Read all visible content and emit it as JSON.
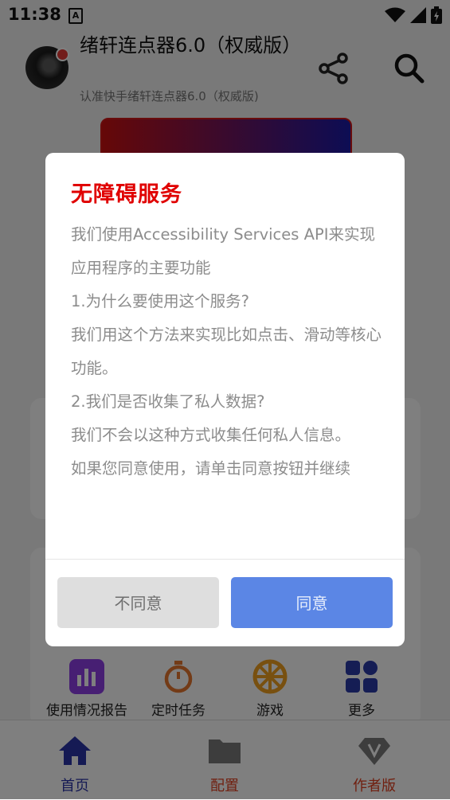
{
  "status_bar": {
    "time": "11:38",
    "notification_icon": "A"
  },
  "header": {
    "title": "绪轩连点器6.0（权威版）",
    "subtitle": "认准快手绪轩连点器6.0（权威版)"
  },
  "quick_actions": [
    {
      "label": "使用情况报告",
      "icon": "bar-chart-icon"
    },
    {
      "label": "定时任务",
      "icon": "stopwatch-icon"
    },
    {
      "label": "游戏",
      "icon": "wheel-icon"
    },
    {
      "label": "更多",
      "icon": "grid-icon"
    }
  ],
  "bottom_nav": [
    {
      "label": "首页",
      "icon": "home-icon",
      "active": true
    },
    {
      "label": "配置",
      "icon": "folder-icon",
      "active": false
    },
    {
      "label": "作者版",
      "icon": "diamond-icon",
      "active": false
    }
  ],
  "dialog": {
    "title": "无障碍服务",
    "paragraphs": [
      "我们使用Accessibility Services API来实现应用程序的主要功能",
      "1.为什么要使用这个服务?",
      "我们用这个方法来实现比如点击、滑动等核心功能。",
      "2.我们是否收集了私人数据?",
      "我们不会以这种方式收集任何私人信息。",
      "如果您同意使用，请单击同意按钮并继续"
    ],
    "disagree_label": "不同意",
    "agree_label": "同意"
  },
  "colors": {
    "dialog_title": "#e00000",
    "agree_button": "#5b86e5",
    "disagree_button": "#dedede",
    "nav_active": "#2b35a8",
    "nav_inactive": "#e04020"
  }
}
